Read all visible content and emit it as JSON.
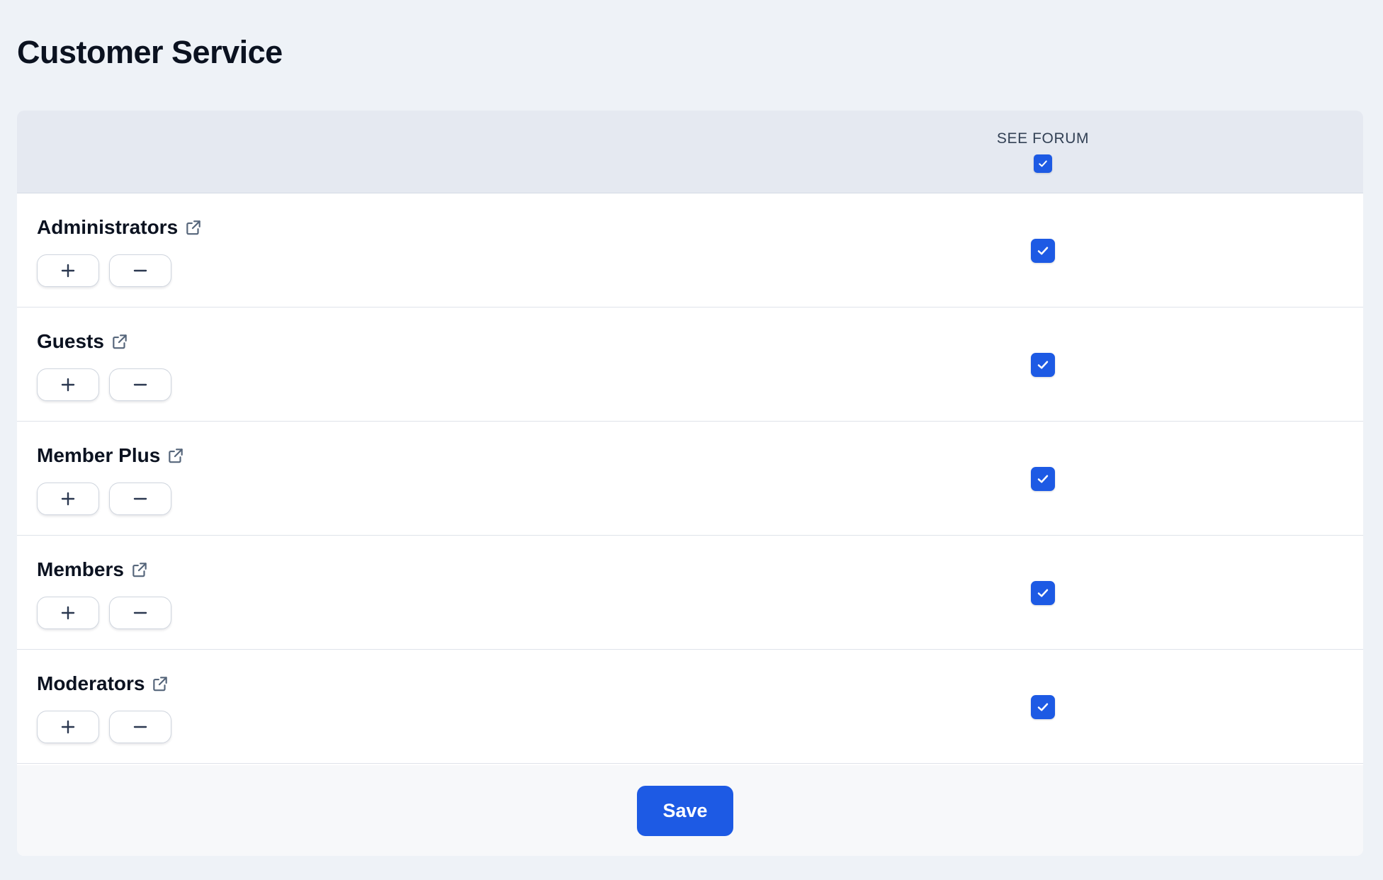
{
  "page": {
    "title": "Customer Service"
  },
  "table": {
    "column_header": "SEE FORUM",
    "column_all_checked": true,
    "rows": [
      {
        "name": "Administrators",
        "see_forum": true
      },
      {
        "name": "Guests",
        "see_forum": true
      },
      {
        "name": "Member Plus",
        "see_forum": true
      },
      {
        "name": "Members",
        "see_forum": true
      },
      {
        "name": "Moderators",
        "see_forum": true
      }
    ]
  },
  "footer": {
    "save_label": "Save"
  },
  "icons": {
    "external": "external-link-icon",
    "plus": "plus-icon",
    "minus": "minus-icon",
    "check": "check-icon"
  },
  "colors": {
    "accent": "#1d5ae4",
    "background": "#eef2f7",
    "header_bg": "#e5e9f1"
  }
}
